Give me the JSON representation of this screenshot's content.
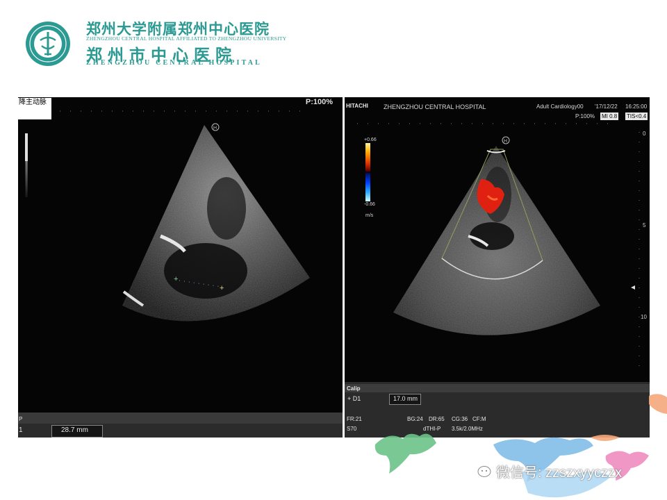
{
  "header": {
    "cn_line1": "郑州大学附属郑州中心医院",
    "en_line1": "ZHENGZHOU CENTRAL HOSPITAL AFFILIATED TO ZHENGZHOU UNIVERSITY",
    "cn_line2": "郑州市中心医院",
    "en_line2": "ZHENGZHOU CENTRAL HOSPITAL"
  },
  "left_panel": {
    "label": "降主动脉",
    "power": "P:100%",
    "meas_prefix": "P",
    "meas_index": "1",
    "meas_value": "28.7 mm"
  },
  "right_panel": {
    "brand": "HITACHI",
    "hospital": "ZHENGZHOU CENTRAL HOSPITAL",
    "preset": "Adult Cardiology00",
    "date": "'17/12/22",
    "time": "16:25:00",
    "power": "P:100%",
    "mi": "MI 0.8",
    "tis": "TIS<0.4",
    "scale_max": "+0.66",
    "scale_min": "-0.66",
    "scale_unit": "m/s",
    "depth_labels": [
      "0",
      "5",
      "10"
    ],
    "calip_label": "Calip",
    "meas_index": "+ D1",
    "meas_value": "17.0 mm",
    "params": {
      "fr": "FR:21",
      "s": "S70",
      "bg": "BG:24",
      "dr": "DR:65",
      "cg": "CG:36",
      "cf": "CF:M",
      "mode": "dTHI-P",
      "freq": "3.5k/2.0MHz"
    }
  },
  "watermark": {
    "text": "微信号: zzszxyyczzx"
  },
  "colors": {
    "brand_teal": "#2a9a92",
    "leaf_green": "#6cc38a",
    "leaf_blue": "#7ab8e6",
    "leaf_pink": "#f08cc0",
    "leaf_orange": "#f5a77a"
  }
}
